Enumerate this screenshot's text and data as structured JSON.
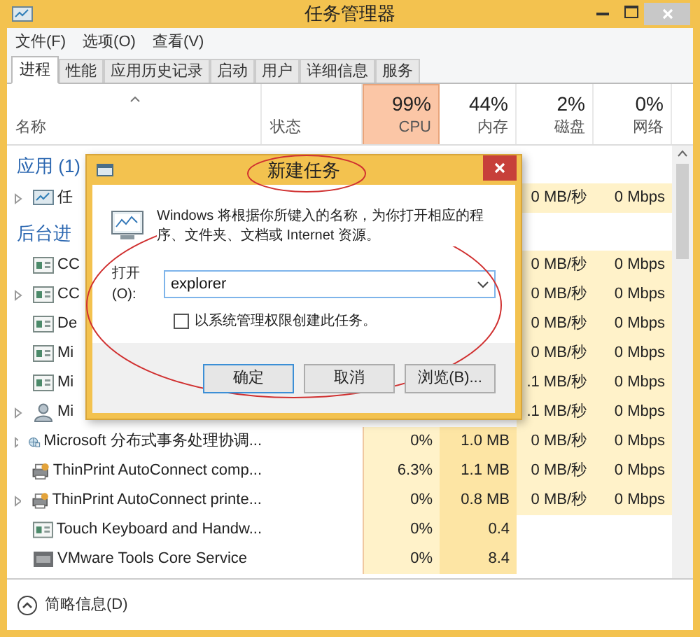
{
  "window": {
    "title": "任务管理器"
  },
  "menu": [
    "文件(F)",
    "选项(O)",
    "查看(V)"
  ],
  "tabs": [
    {
      "label": "进程",
      "selected": true
    },
    {
      "label": "性能",
      "selected": false
    },
    {
      "label": "应用历史记录",
      "selected": false
    },
    {
      "label": "启动",
      "selected": false
    },
    {
      "label": "用户",
      "selected": false
    },
    {
      "label": "详细信息",
      "selected": false
    },
    {
      "label": "服务",
      "selected": false
    }
  ],
  "columns": [
    {
      "label": "名称",
      "selected": false
    },
    {
      "label": "状态",
      "selected": false
    },
    {
      "percent": "99%",
      "label": "CPU",
      "selected": true
    },
    {
      "percent": "44%",
      "label": "内存",
      "selected": false
    },
    {
      "percent": "2%",
      "label": "磁盘",
      "selected": false
    },
    {
      "percent": "0%",
      "label": "网络",
      "selected": false
    }
  ],
  "groups": [
    {
      "title": "应用 (1)",
      "rows": [
        {
          "kind": "app",
          "expandable": true,
          "name": "任",
          "disk": "0 MB/秒",
          "network": "0 Mbps"
        }
      ]
    },
    {
      "title": "后台进",
      "rows": [
        {
          "kind": "service",
          "expandable": false,
          "name": "CC",
          "disk": "0 MB/秒",
          "network": "0 Mbps"
        },
        {
          "kind": "service",
          "expandable": true,
          "name": "CC",
          "disk": "0 MB/秒",
          "network": "0 Mbps"
        },
        {
          "kind": "service",
          "expandable": false,
          "name": "De",
          "disk": "0 MB/秒",
          "network": "0 Mbps"
        },
        {
          "kind": "service",
          "expandable": false,
          "name": "Mi",
          "disk": "0 MB/秒",
          "network": "0 Mbps"
        },
        {
          "kind": "service",
          "expandable": false,
          "name": "Mi",
          "disk": ".1 MB/秒",
          "network": "0 Mbps"
        },
        {
          "kind": "user",
          "expandable": true,
          "name": "Mi",
          "disk": ".1 MB/秒",
          "network": "0 Mbps"
        },
        {
          "kind": "globe",
          "expandable": true,
          "name": "Microsoft 分布式事务处理协调...",
          "cpu": "0%",
          "memory": "1.0 MB",
          "disk": "0 MB/秒",
          "network": "0 Mbps"
        },
        {
          "kind": "printer",
          "expandable": false,
          "name": "ThinPrint AutoConnect comp...",
          "cpu": "6.3%",
          "memory": "1.1 MB",
          "disk": "0 MB/秒",
          "network": "0 Mbps"
        },
        {
          "kind": "printer",
          "expandable": true,
          "name": "ThinPrint AutoConnect printe...",
          "cpu": "0%",
          "memory": "0.8 MB",
          "disk": "0 MB/秒",
          "network": "0 Mbps"
        },
        {
          "kind": "service",
          "expandable": false,
          "name": "Touch Keyboard and Handw...",
          "cpu": "0%",
          "memory": "0.4"
        },
        {
          "kind": "vm",
          "expandable": false,
          "name": "VMware Tools Core Service",
          "cpu": "0%",
          "memory": "8.4"
        }
      ]
    }
  ],
  "dialog": {
    "title": "新建任务",
    "message": "Windows 将根据你所键入的名称，为你打开相应的程序、文件夹、文档或 Internet 资源。",
    "open_label": "打开(O):",
    "value": "explorer",
    "checkbox": {
      "label": "以系统管理权限创建此任务。",
      "checked": false
    },
    "buttons": [
      {
        "label": "确定",
        "default": true
      },
      {
        "label": "取消",
        "default": false
      },
      {
        "label": "浏览(B)...",
        "default": false
      }
    ]
  },
  "footer": {
    "label": "简略信息(D)"
  }
}
